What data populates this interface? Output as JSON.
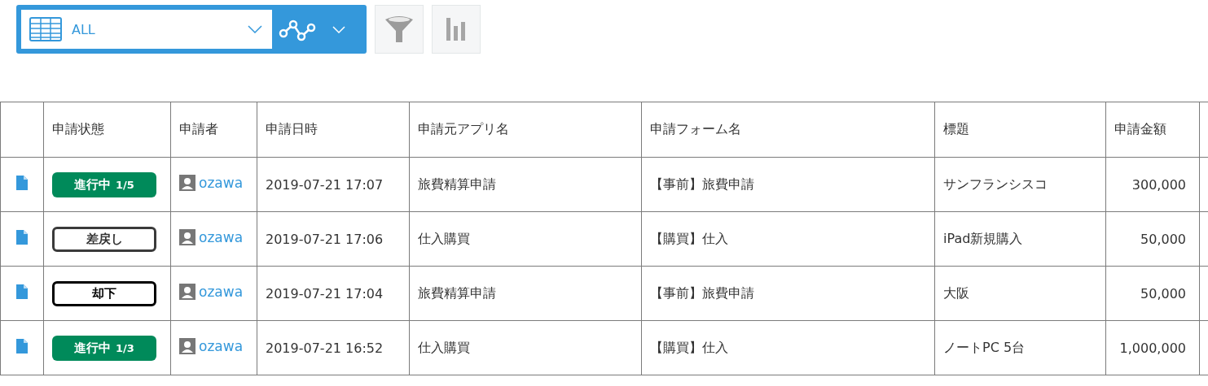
{
  "toolbar": {
    "view_select": {
      "value": "ALL"
    }
  },
  "table": {
    "columns": [
      "申請状態",
      "申請者",
      "申請日時",
      "申請元アプリ名",
      "申請フォーム名",
      "標題",
      "申請金額"
    ],
    "rows": [
      {
        "status": {
          "kind": "in_progress",
          "label": "進行中",
          "step": "1/5"
        },
        "applicant": "ozawa",
        "date": "2019-07-21 17:07",
        "app": "旅費精算申請",
        "form": "【事前】旅費申請",
        "title": "サンフランシスコ",
        "amount": "300,000"
      },
      {
        "status": {
          "kind": "sent_back",
          "label": "差戻し"
        },
        "applicant": "ozawa",
        "date": "2019-07-21 17:06",
        "app": "仕入購買",
        "form": "【購買】仕入",
        "title": "iPad新規購入",
        "amount": "50,000"
      },
      {
        "status": {
          "kind": "rejected",
          "label": "却下"
        },
        "applicant": "ozawa",
        "date": "2019-07-21 17:04",
        "app": "旅費精算申請",
        "form": "【事前】旅費申請",
        "title": "大阪",
        "amount": "50,000"
      },
      {
        "status": {
          "kind": "in_progress",
          "label": "進行中",
          "step": "1/3"
        },
        "applicant": "ozawa",
        "date": "2019-07-21 16:52",
        "app": "仕入購買",
        "form": "【購買】仕入",
        "title": "ノートPC 5台",
        "amount": "1,000,000"
      }
    ]
  }
}
